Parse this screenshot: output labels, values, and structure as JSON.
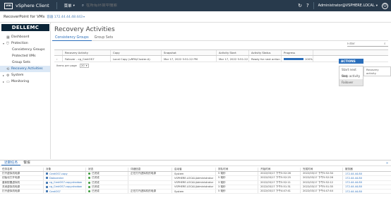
{
  "header": {
    "logo_text": "vm",
    "app_title": "vSphere Client",
    "menu_label": "菜单",
    "search_placeholder": "在所有环境中搜索",
    "user": "Administrator@VSPHERE.LOCAL"
  },
  "subheader": {
    "title": "RecoverPoint for VMs",
    "host": "容器 172.44.44.48:443"
  },
  "sidebar": {
    "logo_text": "D&#8203;ELLEMC",
    "items": [
      {
        "label": "Dashboard"
      },
      {
        "label": "Protection"
      },
      {
        "label": "Consistency Groups"
      },
      {
        "label": "Protected VMs"
      },
      {
        "label": "Group Sets"
      },
      {
        "label": "Recovery Activities"
      },
      {
        "label": "System"
      },
      {
        "label": "Monitoring"
      }
    ]
  },
  "main": {
    "title": "Recovery Activities",
    "tabs": [
      {
        "label": "Consistency Groups"
      },
      {
        "label": "Group Sets"
      }
    ],
    "filter_placeholder": "Filter",
    "columns": [
      "Recovery Activity",
      "Copy",
      "Snapshot",
      "Activity Start",
      "Activity Status",
      "Progress"
    ],
    "row": {
      "activity": "Failover - cg_CentOS7",
      "copy": "Local Copy (vRPA/Cluster-A)",
      "snapshot": "Mar 17, 2022 5:51:22 PM",
      "start": "Mar 17, 2022 5:51:22 PM",
      "status": "Ready for next action",
      "progress": 100,
      "progress_text": "100%"
    },
    "footer": {
      "label": "Items per page",
      "value": "20"
    },
    "actions": {
      "button": "ACTIONS",
      "items": [
        "Start next test",
        "Stop activity",
        "Failover"
      ],
      "tooltip": "Recovery activity"
    }
  },
  "tasks": {
    "tabs": [
      {
        "label": "近期任务"
      },
      {
        "label": "警报"
      }
    ],
    "collapse": "»",
    "columns": [
      "任务名称",
      "对象",
      "状态",
      "详细信息",
      "启动者",
      "排队时间",
      "开始时间",
      "完成时间",
      "服务器"
    ],
    "rows": [
      {
        "name": "打开虚拟机电源",
        "object": "CentOS7-copy",
        "status": "已完成",
        "details": "正在打开虚拟机的电源",
        "initiator": "System",
        "queued": "5 毫秒",
        "start": "2022/03/17 下午5:52:26",
        "end": "2022/03/17 下午5:52:34",
        "server": "172.44.44.80"
      },
      {
        "name": "初始化打开电源",
        "object": "Datacenter",
        "status": "已完成",
        "details": "",
        "initiator": "VSPHERE.LOCAL\\Administrator",
        "queued": "5 毫秒",
        "start": "2022/03/17 下午5:52:25",
        "end": "2022/03/17 下午5:52:26",
        "server": "172.44.44.80"
      },
      {
        "name": "重新配置虚拟机",
        "object": "cg_CentOS7.copy.shadow",
        "status": "已完成",
        "details": "",
        "initiator": "VSPHERE.LOCAL\\Administrator",
        "queued": "3 毫秒",
        "start": "2022/03/17 下午5:52:11",
        "end": "2022/03/17 下午5:52:12",
        "server": "172.44.44.80"
      },
      {
        "name": "关闭虚拟机电源",
        "object": "cg_CentOS7.copy.shadow",
        "status": "已完成",
        "details": "",
        "initiator": "VSPHERE.LOCAL\\Administrator",
        "queued": "3 毫秒",
        "start": "2022/03/17 下午5:51:31",
        "end": "2022/03/17 下午5:51:35",
        "server": "172.44.44.80"
      },
      {
        "name": "打开虚拟机电源",
        "object": "CentOS7",
        "status": "已完成",
        "details": "正在打开虚拟机的电源",
        "initiator": "System",
        "queued": "5 毫秒",
        "start": "2022/03/17 下午4:47:41",
        "end": "2022/03/17 下午4:47:44",
        "server": "172.44.44.80"
      }
    ]
  }
}
